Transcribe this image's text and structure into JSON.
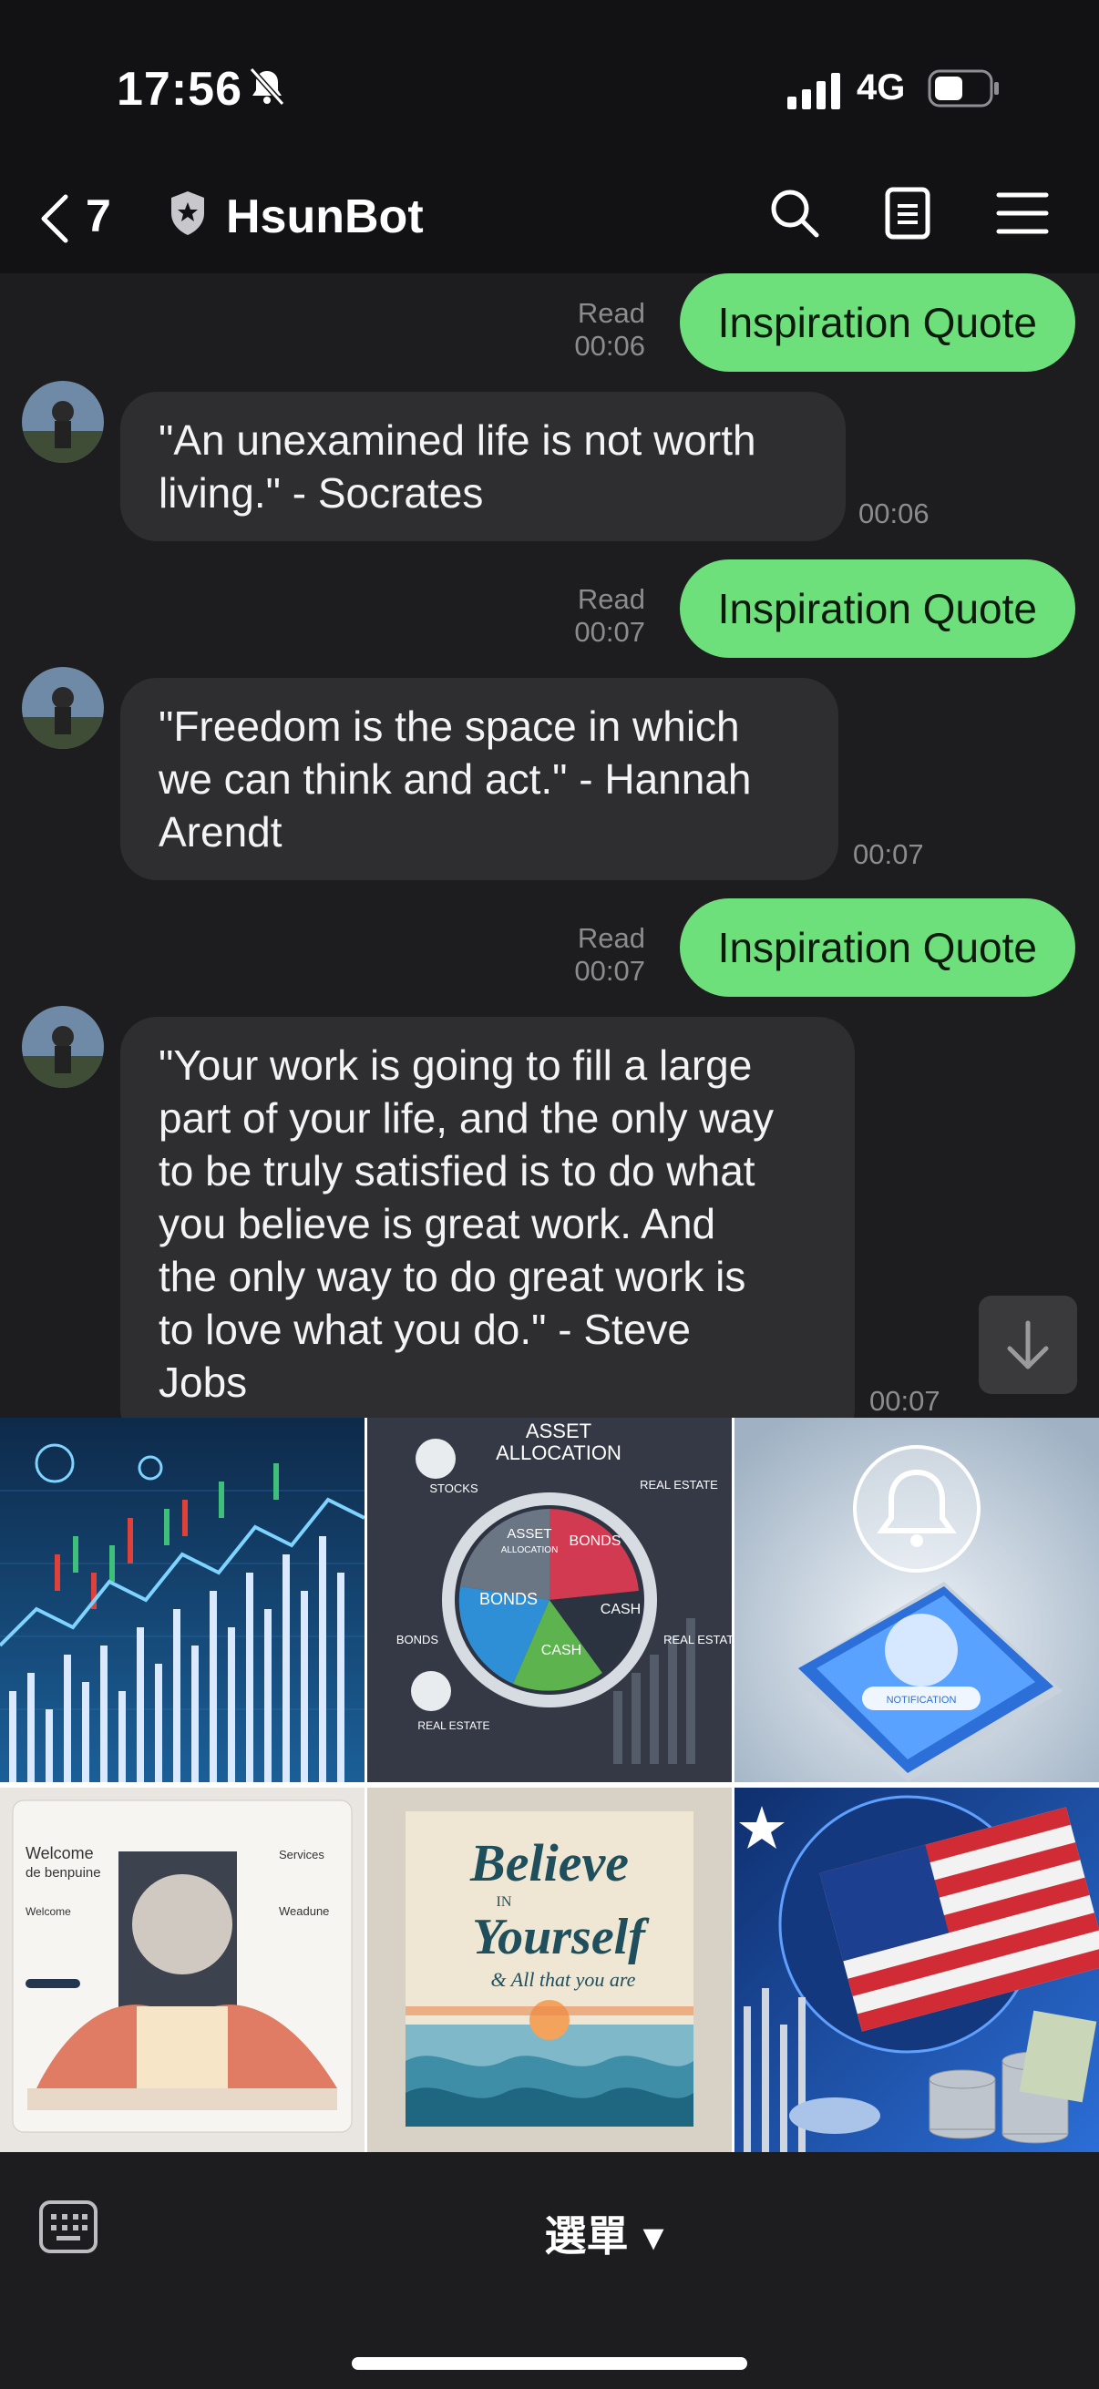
{
  "status": {
    "time": "17:56",
    "network": "4G"
  },
  "header": {
    "unread_count": "7",
    "title": "HsunBot"
  },
  "messages": {
    "out1": {
      "text": "Inspiration Quote",
      "read": "Read",
      "time": "00:06"
    },
    "in1": {
      "line1": "\"An unexamined life is not worth",
      "line2": "living.\" - Socrates",
      "time": "00:06"
    },
    "out2": {
      "text": "Inspiration Quote",
      "read": "Read",
      "time": "00:07"
    },
    "in2": {
      "line1": "\"Freedom is the space in which",
      "line2": "we can think and act.\" - Hannah",
      "line3": "Arendt",
      "time": "00:07"
    },
    "out3": {
      "text": "Inspiration Quote",
      "read": "Read",
      "time": "00:07"
    },
    "in3": {
      "line1": "\"Your work is going to fill a large",
      "line2": "part of your life, and the only way",
      "line3": "to be truly satisfied is to do what",
      "line4": "you believe is great work. And",
      "line5": "the only way to do great work is",
      "line6": "to love what you do.\" - Steve",
      "line7": "Jobs",
      "time": "00:07"
    }
  },
  "rich_menu": {
    "tile2": {
      "title1": "ASSET",
      "title2": "ALLOCATION",
      "stocks": "STOCKS",
      "real_estate": "REAL ESTATE",
      "bonds": "BONDS",
      "cash": "CASH",
      "asset": "ASSET",
      "allocation": "ALLOCATION",
      "wbonds": "BONDS",
      "wcash": "CASH",
      "wreal": "REAL ESTATE",
      "wreal2": "REAL ESTATE"
    },
    "tile3": {
      "label": "NOTIFICATION"
    },
    "tile4": {
      "welcome_big": "Welcome",
      "welcome_sub": "de benpuine",
      "welcome": "Welcome",
      "services": "Services",
      "weadune": "Weadune"
    },
    "tile5": {
      "line1": "Believe",
      "line2": "IN",
      "line3": "Yourself",
      "line4": "& All that you are"
    }
  },
  "bottom": {
    "menu_label": "選單 ▾"
  },
  "colors": {
    "outgoing": "#6de07b",
    "incoming": "#2e2e31",
    "background": "#1d1d1f",
    "bar": "#121214"
  },
  "icons": [
    "bell-slash-icon",
    "signal-icon",
    "battery-icon",
    "chevron-left-icon",
    "shield-icon",
    "search-icon",
    "notes-icon",
    "hamburger-menu-icon",
    "arrow-down-icon",
    "keyboard-icon"
  ]
}
